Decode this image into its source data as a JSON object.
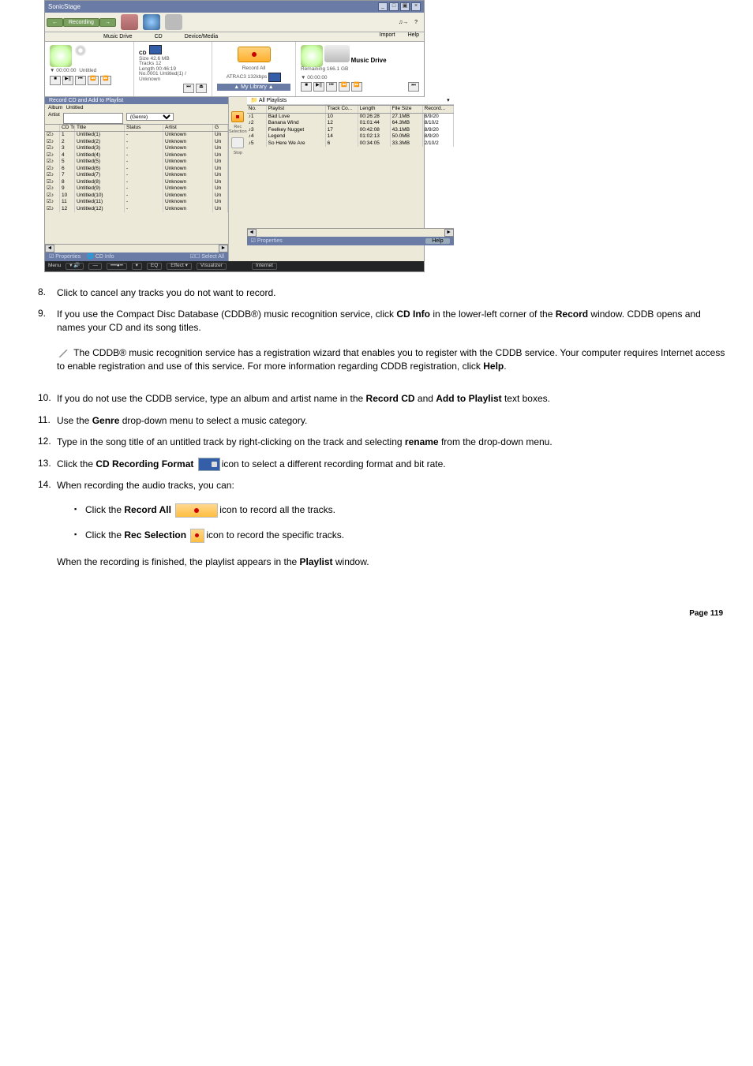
{
  "screenshot": {
    "title": "SonicStage",
    "nav": {
      "recording": "Recording",
      "import": "Import",
      "help": "Help"
    },
    "tabs": {
      "md": "Music Drive",
      "cd": "CD",
      "dev": "Device/Media"
    },
    "cd_panel": {
      "time": "00:00:00",
      "name": "Untitled",
      "label_cd": "CD",
      "size": "Size 42.6 MB",
      "tracks": "Tracks      12",
      "length": "Length 00:46:19",
      "track_info": "No.0001 Untitled(1) / Unknown"
    },
    "record_panel": {
      "label": "Record All",
      "format": "ATRAC3 132kbps",
      "mylib": "My Library"
    },
    "drive_panel": {
      "title": "Music Drive",
      "remaining": "Remaining 166.1 GB",
      "time": "00:00:00"
    },
    "left": {
      "header": "Record CD and Add to Playlist",
      "album_label": "Album",
      "album_value": "Untitled",
      "artist_label": "Artist",
      "genre_placeholder": "(Genre)",
      "cols": {
        "no": "CD Track #",
        "title": "Title",
        "status": "Status",
        "artist": "Artist",
        "g": "G"
      },
      "rows": [
        {
          "n": "1",
          "t": "Untitled(1)",
          "s": "-",
          "a": "Unknown",
          "g": "Un"
        },
        {
          "n": "2",
          "t": "Untitled(2)",
          "s": "-",
          "a": "Unknown",
          "g": "Un"
        },
        {
          "n": "3",
          "t": "Untitled(3)",
          "s": "-",
          "a": "Unknown",
          "g": "Un"
        },
        {
          "n": "4",
          "t": "Untitled(4)",
          "s": "-",
          "a": "Unknown",
          "g": "Un"
        },
        {
          "n": "5",
          "t": "Untitled(5)",
          "s": "-",
          "a": "Unknown",
          "g": "Un"
        },
        {
          "n": "6",
          "t": "Untitled(6)",
          "s": "-",
          "a": "Unknown",
          "g": "Un"
        },
        {
          "n": "7",
          "t": "Untitled(7)",
          "s": "-",
          "a": "Unknown",
          "g": "Un"
        },
        {
          "n": "8",
          "t": "Untitled(8)",
          "s": "-",
          "a": "Unknown",
          "g": "Un"
        },
        {
          "n": "9",
          "t": "Untitled(9)",
          "s": "-",
          "a": "Unknown",
          "g": "Un"
        },
        {
          "n": "10",
          "t": "Untitled(10)",
          "s": "-",
          "a": "Unknown",
          "g": "Un"
        },
        {
          "n": "11",
          "t": "Untitled(11)",
          "s": "-",
          "a": "Unknown",
          "g": "Un"
        },
        {
          "n": "12",
          "t": "Untitled(12)",
          "s": "-",
          "a": "Unknown",
          "g": "Un"
        }
      ]
    },
    "center": {
      "rec_sel": "Rec Selection",
      "stop": "Stop"
    },
    "right": {
      "header": "All Playlists",
      "cols": {
        "no": "No.",
        "pl": "Playlist",
        "tc": "Track Co...",
        "len": "Length",
        "fs": "File Size",
        "rec": "Record..."
      },
      "rows": [
        {
          "n": "1",
          "pl": "Bad Love",
          "tc": "10",
          "len": "00:26:28",
          "fs": "27.1MB",
          "rec": "8/9/20"
        },
        {
          "n": "2",
          "pl": "Banana Wind",
          "tc": "12",
          "len": "01:01:44",
          "fs": "64.3MB",
          "rec": "8/10/2"
        },
        {
          "n": "3",
          "pl": "Feelkey Nugget",
          "tc": "17",
          "len": "00:42:08",
          "fs": "43.1MB",
          "rec": "8/9/20"
        },
        {
          "n": "4",
          "pl": "Legend",
          "tc": "14",
          "len": "01:02:13",
          "fs": "50.0MB",
          "rec": "8/9/20"
        },
        {
          "n": "5",
          "pl": "So Here We Are",
          "tc": "6",
          "len": "00:34:05",
          "fs": "33.3MB",
          "rec": "2/10/2"
        }
      ]
    },
    "footer_left": {
      "props": "Properties",
      "cd": "CD Info",
      "sel": "Select All"
    },
    "footer_right": {
      "props": "Properties",
      "help": "Help"
    },
    "bottom": {
      "menu": "Menu",
      "eq": "EQ",
      "effect": "Effect",
      "vis": "Visualizer",
      "net": "Internet"
    }
  },
  "steps": {
    "s8": {
      "num": "8.",
      "text": "Click to cancel any tracks you do not want to record."
    },
    "s9": {
      "num": "9.",
      "t1": "If you use the Compact Disc Database (CDDB®) music recognition service, click ",
      "b1": "CD Info",
      "t2": " in the lower-left corner of the ",
      "b2": "Record",
      "t3": " window. CDDB opens and names your CD and its song titles."
    },
    "note": {
      "t1": " The CDDB® music recognition service has a registration wizard that enables you to register with the CDDB service. Your computer requires Internet access to enable registration and use of this service. For more information regarding CDDB registration, click ",
      "b1": "Help",
      "t2": "."
    },
    "s10": {
      "num": "10.",
      "t1": "If you do not use the CDDB service, type an album and artist name in the ",
      "b1": "Record CD",
      "t2": " and ",
      "b2": "Add to Playlist",
      "t3": " text boxes."
    },
    "s11": {
      "num": "11.",
      "t1": "Use the ",
      "b1": "Genre",
      "t2": " drop-down menu to select a music category."
    },
    "s12": {
      "num": "12.",
      "t1": "Type in the song title of an untitled track by right-clicking on the track and selecting ",
      "b1": "rename",
      "t2": " from the drop-down menu."
    },
    "s13": {
      "num": "13.",
      "t1": "Click the ",
      "b1": "CD Recording Format ",
      "t2": "icon to select a different recording format and bit rate."
    },
    "s14": {
      "num": "14.",
      "intro": "When recording the audio tracks, you can:",
      "a": {
        "t1": "Click the ",
        "b1": "Record All ",
        "t2": "icon to record all the tracks."
      },
      "b": {
        "t1": "Click the ",
        "b1": "Rec Selection ",
        "t2": "icon to record the specific tracks."
      },
      "outro1": "When the recording is finished, the playlist appears in the ",
      "ob": "Playlist",
      "outro2": " window."
    }
  },
  "page_number": "Page 119"
}
